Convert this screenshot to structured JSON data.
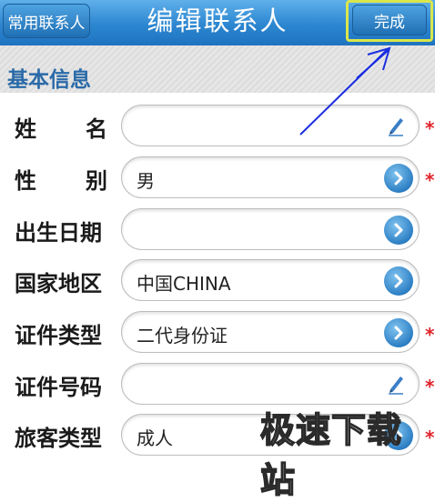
{
  "header": {
    "back_label": "常用联系人",
    "title": "编辑联系人",
    "done_label": "完成"
  },
  "section": {
    "title": "基本信息"
  },
  "fields": [
    {
      "label_chars": [
        "姓",
        "名"
      ],
      "value": "",
      "control": "pencil-icon",
      "required": true
    },
    {
      "label_chars": [
        "性",
        "别"
      ],
      "value": "男",
      "control": "chevron-right-icon",
      "required": true
    },
    {
      "label": "出生日期",
      "value": "",
      "control": "chevron-right-icon",
      "required": false
    },
    {
      "label": "国家地区",
      "value": "中国CHINA",
      "control": "chevron-right-icon",
      "required": false
    },
    {
      "label": "证件类型",
      "value": "二代身份证",
      "control": "chevron-right-icon",
      "required": true
    },
    {
      "label": "证件号码",
      "value": "",
      "control": "pencil-icon",
      "required": true
    },
    {
      "label": "旅客类型",
      "value": "成人",
      "control": "chevron-right-icon",
      "required": true
    }
  ],
  "required_mark": "*",
  "watermark": "极速下载站",
  "colors": {
    "header_blue": "#2c86d0",
    "section_title": "#2a6aa8",
    "required_red": "#e0242b",
    "annotation_blue": "#1a2ee0",
    "highlight_yellow": "#d9e64c"
  }
}
